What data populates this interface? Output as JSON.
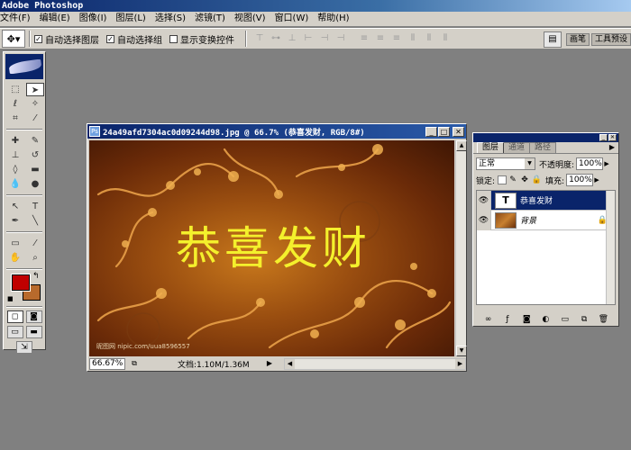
{
  "app": {
    "title": "Adobe Photoshop"
  },
  "menu": [
    "文件(F)",
    "编辑(E)",
    "图像(I)",
    "图层(L)",
    "选择(S)",
    "滤镜(T)",
    "视图(V)",
    "窗口(W)",
    "帮助(H)"
  ],
  "options": {
    "auto_select_layer": {
      "label": "自动选择图层",
      "checked": true
    },
    "auto_select_group": {
      "label": "自动选择组",
      "checked": true
    },
    "show_transform": {
      "label": "显示变换控件",
      "checked": false
    },
    "palette_well_tabs": [
      "画笔",
      "工具预设"
    ]
  },
  "toolbox": {
    "foreground_color": "#c00000",
    "background_color": "#b86a2c"
  },
  "document": {
    "title": "24a49afd7304ac0d09244d98.jpg @ 66.7% (恭喜发财, RGB/8#)",
    "canvas_text": "恭喜发财",
    "watermark": "昵图网 nipic.com/uua8596557",
    "zoom": "66.67%",
    "doc_size": "文档:1.10M/1.36M"
  },
  "layers_palette": {
    "tabs": [
      "图层",
      "通道",
      "路径"
    ],
    "blend_mode": "正常",
    "opacity_label": "不透明度:",
    "opacity": "100%",
    "lock_label": "锁定:",
    "fill_label": "填充:",
    "fill": "100%",
    "layers": [
      {
        "name": "恭喜发财",
        "type": "text",
        "thumb": "T",
        "selected": true
      },
      {
        "name": "背景",
        "type": "image",
        "locked": true,
        "selected": false
      }
    ]
  }
}
